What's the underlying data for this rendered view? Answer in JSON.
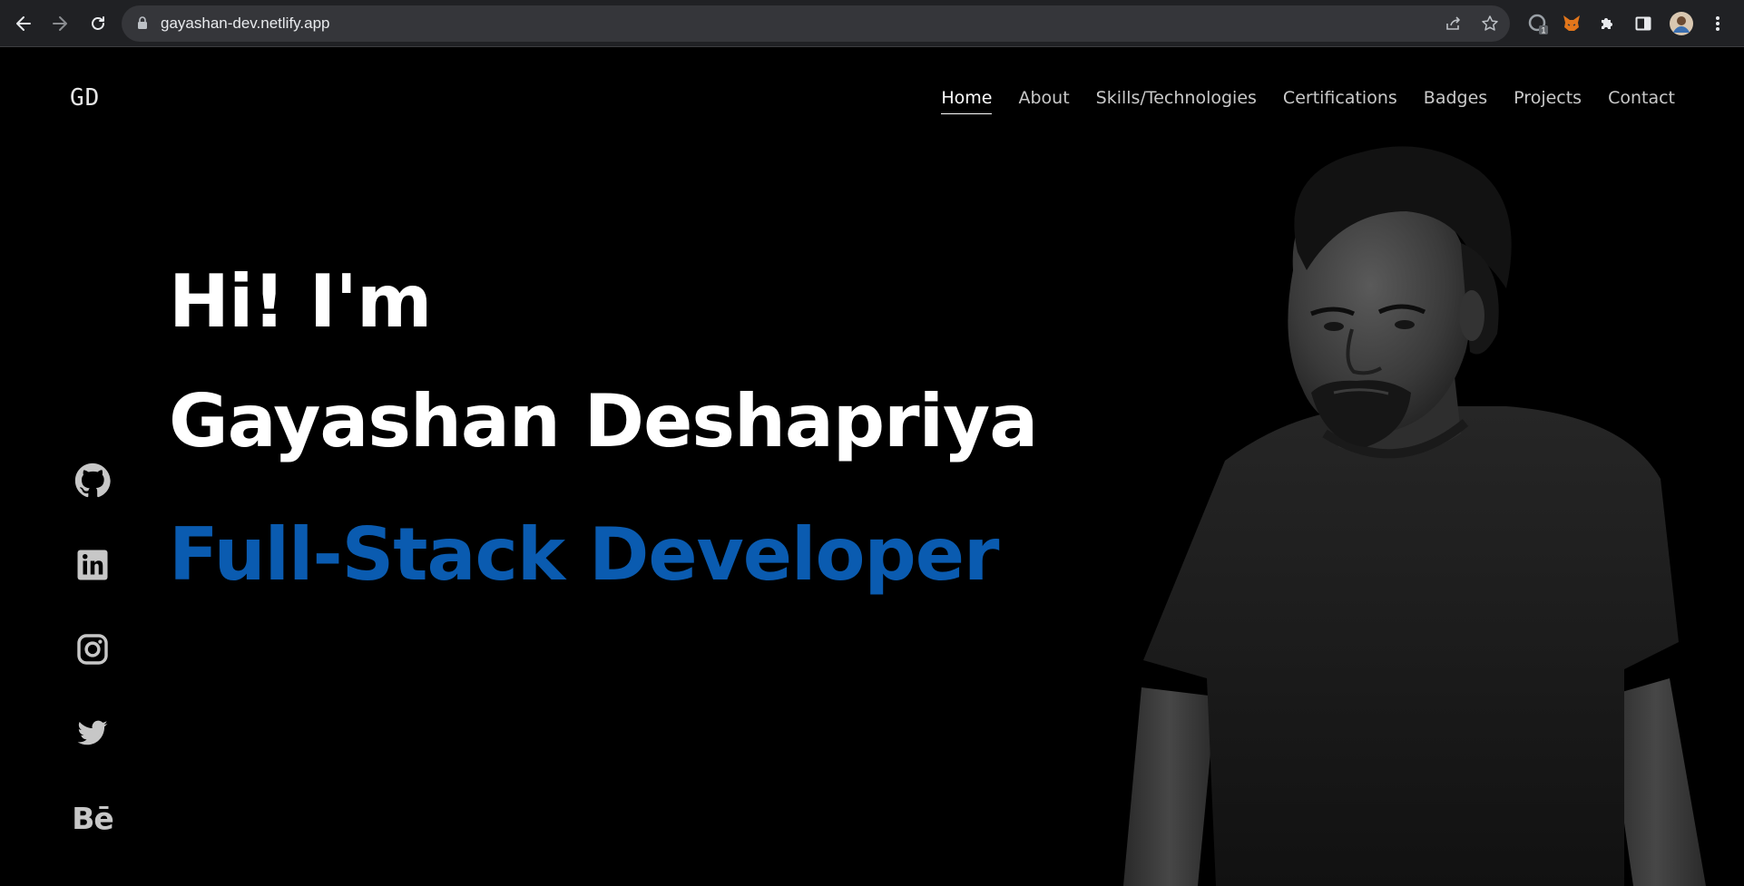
{
  "browser": {
    "url": "gayashan-dev.netlify.app",
    "extension_badge": "1"
  },
  "site": {
    "logo": "GD",
    "nav": [
      {
        "label": "Home",
        "active": true
      },
      {
        "label": "About"
      },
      {
        "label": "Skills/Technologies"
      },
      {
        "label": "Certifications"
      },
      {
        "label": "Badges"
      },
      {
        "label": "Projects"
      },
      {
        "label": "Contact"
      }
    ],
    "hero": {
      "greeting": "Hi! I'm",
      "name": "Gayashan Deshapriya",
      "role": "Full-Stack Developer",
      "role_color": "#0a5bb0"
    },
    "socials": [
      {
        "icon": "github-icon"
      },
      {
        "icon": "linkedin-icon"
      },
      {
        "icon": "instagram-icon"
      },
      {
        "icon": "twitter-icon"
      },
      {
        "icon": "behance-icon",
        "text": "Bē"
      }
    ]
  },
  "colors": {
    "background": "#000000",
    "chrome": "#202124",
    "accent": "#0a5bb0"
  }
}
